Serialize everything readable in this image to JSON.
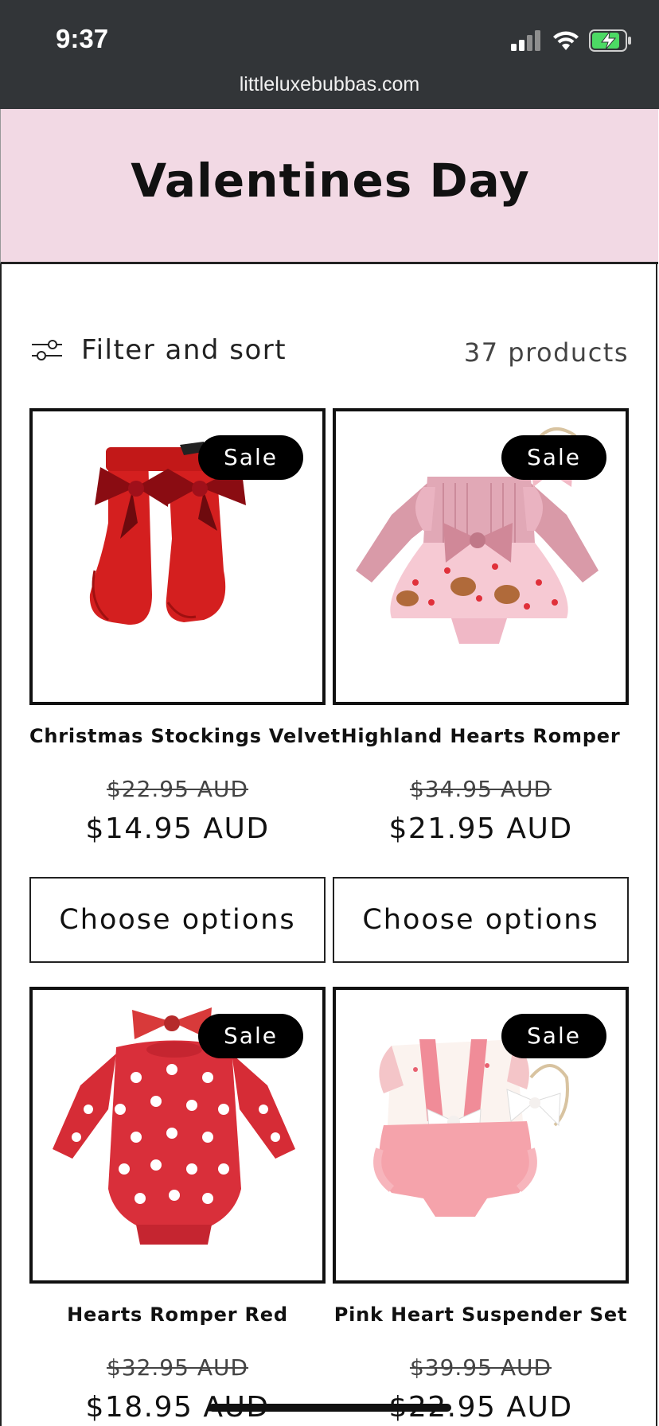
{
  "status_bar": {
    "time": "9:37",
    "url": "littleluxebubbas.com",
    "icons": [
      "signal-icon",
      "wifi-icon",
      "battery-charging-icon"
    ]
  },
  "collection": {
    "title": "Valentines Day"
  },
  "toolbar": {
    "filter_label": "Filter and sort",
    "product_count": "37 products"
  },
  "products": [
    {
      "title": "Christmas Stockings Velvet",
      "badge": "Sale",
      "old_price": "$22.95 AUD",
      "new_price": "$14.95 AUD",
      "button": "Choose options"
    },
    {
      "title": "Highland Hearts Romper",
      "badge": "Sale",
      "old_price": "$34.95 AUD",
      "new_price": "$21.95 AUD",
      "button": "Choose options"
    },
    {
      "title": "Hearts Romper Red",
      "badge": "Sale",
      "old_price": "$32.95 AUD",
      "new_price": "$18.95 AUD"
    },
    {
      "title": "Pink Heart Suspender Set",
      "badge": "Sale",
      "old_price": "$39.95 AUD",
      "new_price": "$22.95 AUD"
    }
  ],
  "colors": {
    "status_bar_bg": "#323538",
    "banner_bg": "#f2d9e4",
    "badge_bg": "#000000",
    "battery_green": "#4cd964"
  }
}
